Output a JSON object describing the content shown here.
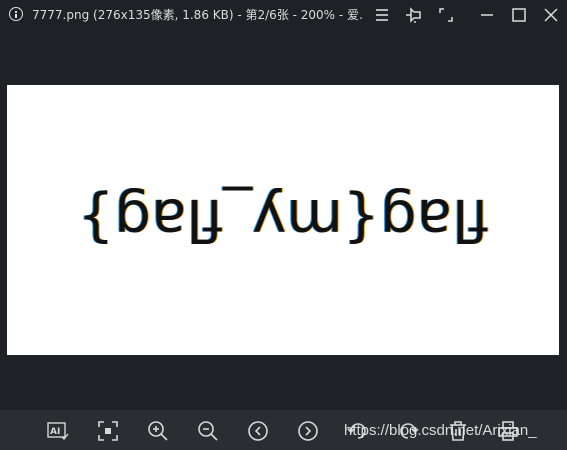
{
  "window": {
    "title": "7777.png (276x135像素, 1.86 KB) - 第2/6张 - 200% - 爱..."
  },
  "image": {
    "text": "flag{my_flag}",
    "rotated": "180deg"
  },
  "toolbar_icons": [
    "ai-icon",
    "fit-screen-icon",
    "zoom-in-icon",
    "zoom-out-icon",
    "previous-icon",
    "next-icon",
    "rotate-left-icon",
    "rotate-right-icon",
    "delete-icon",
    "print-icon"
  ],
  "watermark": "https://blog.csdn.net/Arixian_"
}
